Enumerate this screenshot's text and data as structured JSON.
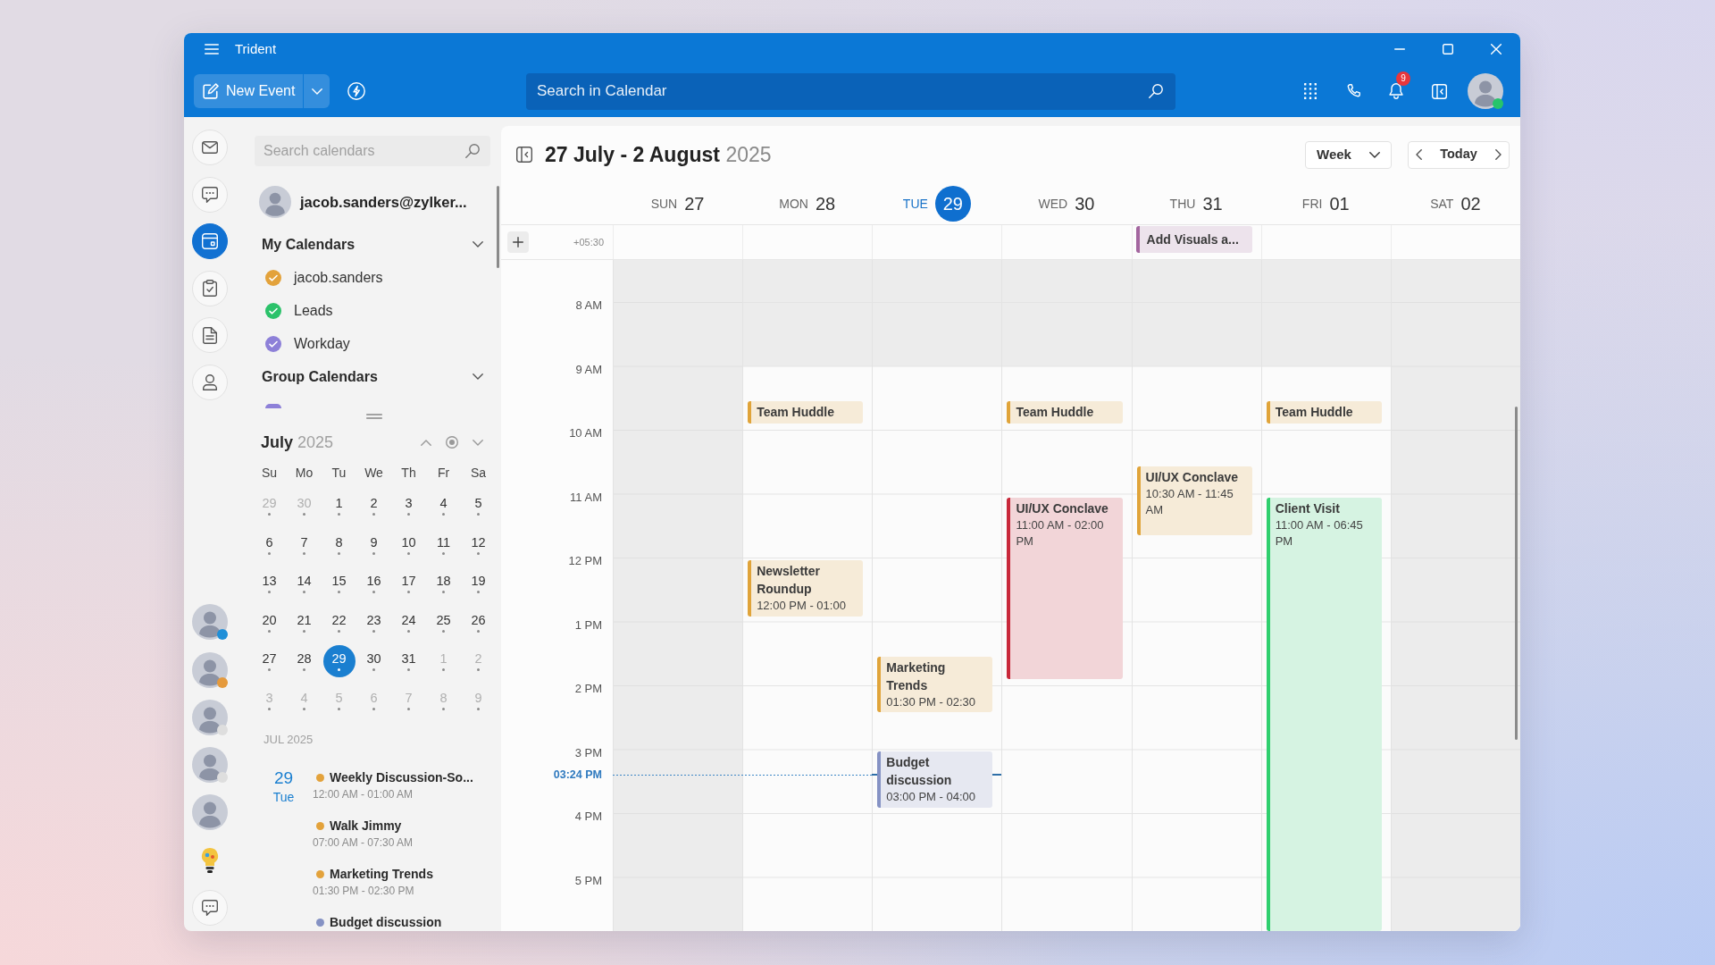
{
  "window": {
    "title": "Trident"
  },
  "toolbar": {
    "new_event_button": "New Event",
    "search": {
      "placeholder": "Search in Calendar"
    },
    "notifications_badge": "9",
    "online": true
  },
  "rail": {
    "apps": [
      {
        "kind": "mail",
        "selected": false
      },
      {
        "kind": "chat",
        "selected": false
      },
      {
        "kind": "calendar",
        "selected": true
      },
      {
        "kind": "tasks",
        "selected": false
      },
      {
        "kind": "notes",
        "selected": false
      },
      {
        "kind": "contacts",
        "selected": false
      }
    ],
    "people": [
      {
        "status_dot": true,
        "color": "#1f8fd8"
      },
      {
        "status_dot": true,
        "color": "#e59a3c"
      },
      {
        "status_dot": true,
        "color": "#dedede"
      },
      {
        "status_dot": true,
        "color": "#dedede"
      },
      {
        "status_dot": false
      }
    ]
  },
  "calendar_panel": {
    "search": {
      "placeholder": "Search calendars"
    },
    "account": "jacob.sanders@zylker...",
    "groups": [
      {
        "title": "My Calendars",
        "expanded": true,
        "calendars": [
          {
            "name": "jacob.sanders",
            "checked": true,
            "color": "#e3a23b"
          },
          {
            "name": "Leads",
            "checked": true,
            "color": "#2bc26a"
          },
          {
            "name": "Workday",
            "checked": true,
            "color": "#8d80d8"
          }
        ]
      },
      {
        "title": "Group Calendars",
        "expanded": true,
        "calendars": [
          {
            "color": "#8d80d8"
          }
        ]
      }
    ]
  },
  "mini_calendar": {
    "month": "July",
    "year": "2025",
    "weekdays": [
      "Su",
      "Mo",
      "Tu",
      "We",
      "Th",
      "Fr",
      "Sa"
    ],
    "weeks": [
      [
        {
          "day": "29",
          "other_month": true,
          "selected": false,
          "has_events": true
        },
        {
          "day": "30",
          "other_month": true,
          "selected": false,
          "has_events": true
        },
        {
          "day": "1",
          "other_month": false,
          "selected": false,
          "has_events": true
        },
        {
          "day": "2",
          "other_month": false,
          "selected": false,
          "has_events": true
        },
        {
          "day": "3",
          "other_month": false,
          "selected": false,
          "has_events": true
        },
        {
          "day": "4",
          "other_month": false,
          "selected": false,
          "has_events": true
        },
        {
          "day": "5",
          "other_month": false,
          "selected": false,
          "has_events": true
        }
      ],
      [
        {
          "day": "6",
          "other_month": false,
          "selected": false,
          "has_events": true
        },
        {
          "day": "7",
          "other_month": false,
          "selected": false,
          "has_events": true
        },
        {
          "day": "8",
          "other_month": false,
          "selected": false,
          "has_events": true
        },
        {
          "day": "9",
          "other_month": false,
          "selected": false,
          "has_events": true
        },
        {
          "day": "10",
          "other_month": false,
          "selected": false,
          "has_events": true
        },
        {
          "day": "11",
          "other_month": false,
          "selected": false,
          "has_events": true
        },
        {
          "day": "12",
          "other_month": false,
          "selected": false,
          "has_events": true
        }
      ],
      [
        {
          "day": "13",
          "other_month": false,
          "selected": false,
          "has_events": true
        },
        {
          "day": "14",
          "other_month": false,
          "selected": false,
          "has_events": true
        },
        {
          "day": "15",
          "other_month": false,
          "selected": false,
          "has_events": true
        },
        {
          "day": "16",
          "other_month": false,
          "selected": false,
          "has_events": true
        },
        {
          "day": "17",
          "other_month": false,
          "selected": false,
          "has_events": true
        },
        {
          "day": "18",
          "other_month": false,
          "selected": false,
          "has_events": true
        },
        {
          "day": "19",
          "other_month": false,
          "selected": false,
          "has_events": true
        }
      ],
      [
        {
          "day": "20",
          "other_month": false,
          "selected": false,
          "has_events": true
        },
        {
          "day": "21",
          "other_month": false,
          "selected": false,
          "has_events": true
        },
        {
          "day": "22",
          "other_month": false,
          "selected": false,
          "has_events": true
        },
        {
          "day": "23",
          "other_month": false,
          "selected": false,
          "has_events": true
        },
        {
          "day": "24",
          "other_month": false,
          "selected": false,
          "has_events": true
        },
        {
          "day": "25",
          "other_month": false,
          "selected": false,
          "has_events": true
        },
        {
          "day": "26",
          "other_month": false,
          "selected": false,
          "has_events": true
        }
      ],
      [
        {
          "day": "27",
          "other_month": false,
          "selected": false,
          "has_events": true
        },
        {
          "day": "28",
          "other_month": false,
          "selected": false,
          "has_events": true
        },
        {
          "day": "29",
          "other_month": false,
          "selected": true,
          "has_events": true
        },
        {
          "day": "30",
          "other_month": false,
          "selected": false,
          "has_events": true
        },
        {
          "day": "31",
          "other_month": false,
          "selected": false,
          "has_events": true
        },
        {
          "day": "1",
          "other_month": true,
          "selected": false,
          "has_events": true
        },
        {
          "day": "2",
          "other_month": true,
          "selected": false,
          "has_events": true
        }
      ],
      [
        {
          "day": "3",
          "other_month": true,
          "selected": false,
          "has_events": true
        },
        {
          "day": "4",
          "other_month": true,
          "selected": false,
          "has_events": true
        },
        {
          "day": "5",
          "other_month": true,
          "selected": false,
          "has_events": true
        },
        {
          "day": "6",
          "other_month": true,
          "selected": false,
          "has_events": true
        },
        {
          "day": "7",
          "other_month": true,
          "selected": false,
          "has_events": true
        },
        {
          "day": "8",
          "other_month": true,
          "selected": false,
          "has_events": true
        },
        {
          "day": "9",
          "other_month": true,
          "selected": false,
          "has_events": true
        }
      ]
    ]
  },
  "agenda": {
    "month": "JUL 2025",
    "days": [
      {
        "date": "29",
        "weekday": "Tue",
        "events": [
          {
            "title": "Weekly Discussion-So...",
            "time": "12:00 AM - 01:00 AM",
            "color": "#e3a23b"
          },
          {
            "title": "Walk Jimmy",
            "time": "07:00 AM - 07:30 AM",
            "color": "#e3a23b"
          },
          {
            "title": "Marketing Trends",
            "time": "01:30 PM - 02:30 PM",
            "color": "#e3a23b"
          },
          {
            "title": "Budget discussion",
            "color": "#8592c4"
          }
        ]
      }
    ]
  },
  "week_view": {
    "title": "27 July - 2 August",
    "year": "2025",
    "view_select": "Week",
    "today_button": "Today",
    "timezone": "+05:30",
    "hours": [
      "8 AM",
      "9 AM",
      "10 AM",
      "11 AM",
      "12 PM",
      "1 PM",
      "2 PM",
      "3 PM",
      "4 PM",
      "5 PM"
    ],
    "now": "03:24 PM",
    "days": [
      {
        "weekday": "SUN",
        "date": "27",
        "today": false,
        "working": false
      },
      {
        "weekday": "MON",
        "date": "28",
        "today": false,
        "working": true,
        "events": [
          {
            "title": "Team Huddle",
            "color": "#e0a43a"
          },
          {
            "title": "Newsletter Roundup",
            "time": "12:00 PM - 01:00",
            "color": "#e0a43a"
          }
        ]
      },
      {
        "weekday": "TUE",
        "date": "29",
        "today": true,
        "working": true,
        "events": [
          {
            "title": "Marketing Trends",
            "time": "01:30 PM - 02:30",
            "color": "#e0a43a"
          },
          {
            "title": "Budget discussion",
            "time": "03:00 PM - 04:00",
            "color": "#8592c4"
          }
        ]
      },
      {
        "weekday": "WED",
        "date": "30",
        "today": false,
        "working": true,
        "events": [
          {
            "title": "Team Huddle",
            "color": "#e0a43a"
          },
          {
            "title": "UI/UX Conclave",
            "time": "11:00 AM - 02:00 PM",
            "color": "#c8283a"
          }
        ]
      },
      {
        "weekday": "THU",
        "date": "31",
        "today": false,
        "working": true,
        "all_day": [
          {
            "title": "Add Visuals a...",
            "color": "#a3669f"
          }
        ],
        "events": [
          {
            "title": "UI/UX Conclave",
            "time": "10:30 AM - 11:45 AM",
            "color": "#e0a43a"
          }
        ]
      },
      {
        "weekday": "FRI",
        "date": "01",
        "today": false,
        "working": true,
        "events": [
          {
            "title": "Team Huddle",
            "color": "#e0a43a"
          },
          {
            "title": "Client Visit",
            "time": "11:00 AM - 06:45 PM",
            "color": "#2fcf6e"
          }
        ]
      },
      {
        "weekday": "SAT",
        "date": "02",
        "today": false,
        "working": false
      }
    ]
  }
}
